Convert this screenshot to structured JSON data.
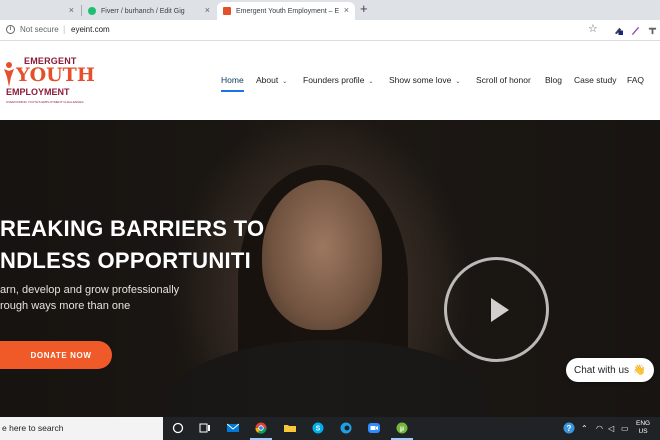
{
  "browser": {
    "tabs": [
      {
        "title": "",
        "close": "×"
      },
      {
        "title": "Fiverr / burhanch / Edit Gig",
        "close": "×"
      },
      {
        "title": "Emergent Youth Employment – E",
        "close": "×"
      }
    ],
    "new_tab": "+",
    "security_label": "Not secure",
    "url": "eyeint.com"
  },
  "logo": {
    "line1": "EMERGENT",
    "line2": "YOUTH",
    "line3": "EMPLOYMENT",
    "tagline": "OVERCOMING YOUTH'S EMPLOYMENT CHALLENGES"
  },
  "nav": {
    "items": [
      {
        "label": "Home",
        "active": true,
        "dropdown": false
      },
      {
        "label": "About",
        "dropdown": true
      },
      {
        "label": "Founders profile",
        "dropdown": true
      },
      {
        "label": "Show some love",
        "dropdown": true
      },
      {
        "label": "Scroll of honor",
        "dropdown": false
      },
      {
        "label": "Blog",
        "dropdown": false
      },
      {
        "label": "Case study",
        "dropdown": false
      },
      {
        "label": "FAQ",
        "dropdown": false
      }
    ]
  },
  "hero": {
    "heading_line1": "REAKING BARRIERS TO",
    "heading_line2": "NDLESS OPPORTUNITI",
    "sub_line1": "arn, develop and grow professionally",
    "sub_line2": "rough ways more than one",
    "donate_label": "DONATE NOW"
  },
  "chat": {
    "label": "Chat with us",
    "emoji": "👋"
  },
  "taskbar": {
    "search_text": "e here to search",
    "language": "ENG",
    "region": "US"
  },
  "colors": {
    "accent": "#f05a28",
    "nav_active": "#0c3c60",
    "brand_maroon": "#8a1c3a"
  }
}
